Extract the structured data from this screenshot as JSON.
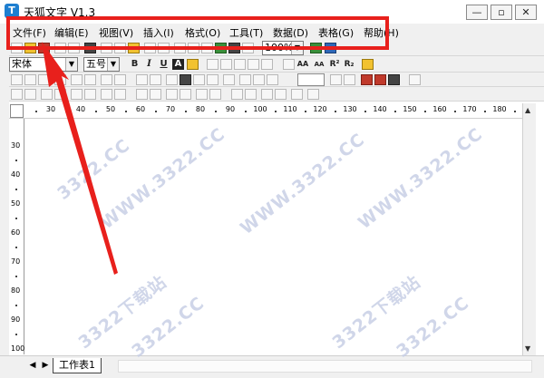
{
  "window": {
    "app_icon": "T",
    "title": "天狐文字 V1.3",
    "controls": [
      "—",
      "▫",
      "✕"
    ]
  },
  "menu": [
    "文件(F)",
    "编辑(E)",
    "视图(V)",
    "插入(I)",
    "格式(O)",
    "工具(T)",
    "数据(D)",
    "表格(G)",
    "帮助(H)"
  ],
  "format_bar": {
    "font_name": "宋体",
    "font_size": "五号",
    "zoom": "100%",
    "bold_label": "B",
    "italic_label": "I",
    "underline_label": "U",
    "font_color_label": "A",
    "superscript_label": "R²",
    "subscript_label": "R₂",
    "font_grow_label": "AA",
    "font_shrink_label": "AA"
  },
  "ruler": {
    "top_ticks": [
      "30",
      "40",
      "50",
      "60",
      "70",
      "80",
      "90",
      "100",
      "110",
      "120",
      "130",
      "140",
      "150",
      "160",
      "170",
      "180"
    ],
    "left_ticks": [
      "30",
      "40",
      "50",
      "60",
      "70",
      "80",
      "90",
      "100"
    ]
  },
  "sheet_tabs": [
    "工作表1"
  ],
  "watermarks": [
    "3322.CC",
    "WWW.3322.CC",
    "3322下载站",
    "WWW.3322.CC",
    "3322.CC",
    "WWW.3322.CC",
    "3322下载站",
    "3322.CC"
  ],
  "annotation": {
    "highlight_color": "#e8201c"
  },
  "colors": {
    "chrome": "#f0f0f0",
    "accent": "#1e7fd0",
    "watermark": "#c8d0e6"
  }
}
